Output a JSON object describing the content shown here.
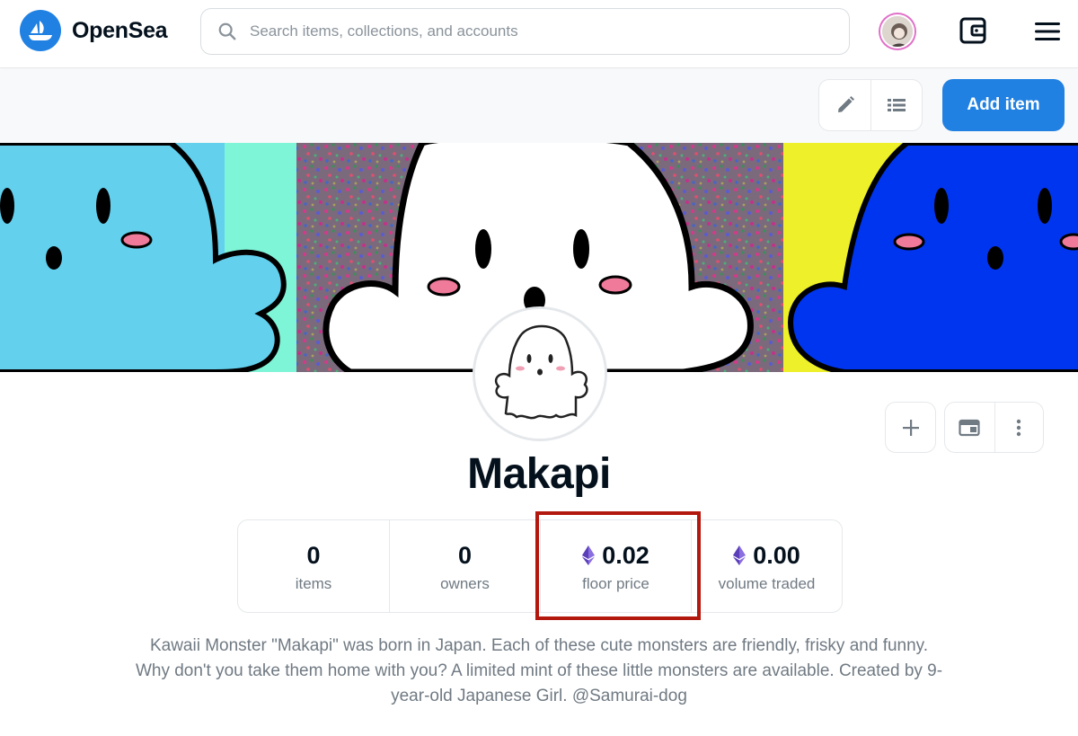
{
  "header": {
    "brand": "OpenSea",
    "search_placeholder": "Search items, collections, and accounts"
  },
  "toolbar": {
    "add_item_label": "Add item"
  },
  "collection": {
    "name": "Makapi",
    "stats": [
      {
        "value": "0",
        "label": "items",
        "eth": false
      },
      {
        "value": "0",
        "label": "owners",
        "eth": false
      },
      {
        "value": "0.02",
        "label": "floor price",
        "eth": true
      },
      {
        "value": "0.00",
        "label": "volume traded",
        "eth": true
      }
    ],
    "description": "Kawaii Monster \"Makapi\" was born in Japan. Each of these cute monsters are friendly, frisky and funny. Why don't you take them home with you? A limited mint of these little monsters are available. Created by 9-year-old Japanese Girl. @Samurai-dog"
  },
  "colors": {
    "brand_blue": "#2081e2",
    "highlight_red": "#b3180e",
    "eth_purple": "#6a4fc8"
  },
  "icons": [
    "opensea-logo-icon",
    "search-icon",
    "wallet-icon",
    "menu-icon",
    "pencil-icon",
    "list-icon",
    "plus-icon",
    "embed-icon",
    "more-vertical-icon",
    "eth-icon"
  ]
}
